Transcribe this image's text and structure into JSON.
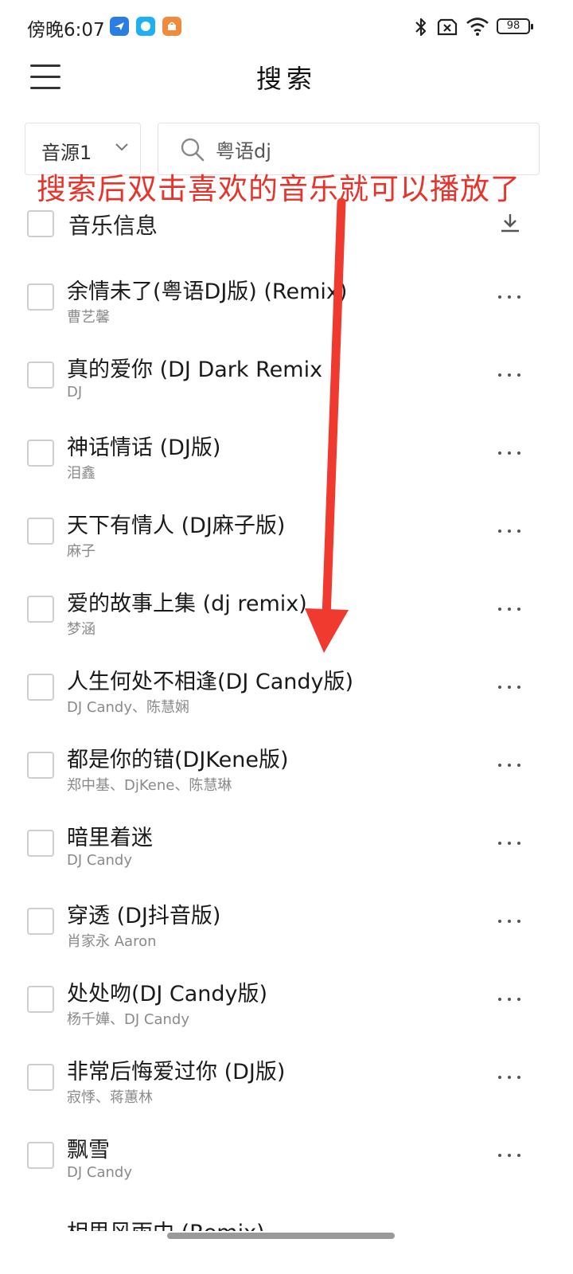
{
  "status_bar": {
    "time": "傍晚6:07",
    "battery": "98",
    "app_icons": [
      "bird-app-icon",
      "chat-app-icon",
      "shop-app-icon"
    ],
    "system_icons": [
      "bluetooth-icon",
      "sim-off-icon",
      "wifi-icon",
      "battery-icon"
    ]
  },
  "header": {
    "title": "搜索",
    "menu_icon": "hamburger-menu-icon"
  },
  "search": {
    "source_label": "音源1",
    "query": "粤语dj"
  },
  "list": {
    "header_label": "音乐信息",
    "songs": [
      {
        "title": "余情未了(粤语DJ版) (Remix)",
        "artist": "曹艺馨"
      },
      {
        "title": "真的爱你 (DJ Dark Remix",
        "artist": "DJ"
      },
      {
        "title": "神话情话 (DJ版)",
        "artist": "泪鑫"
      },
      {
        "title": "天下有情人 (DJ麻子版)",
        "artist": "麻子"
      },
      {
        "title": "爱的故事上集 (dj remix)",
        "artist": "梦涵"
      },
      {
        "title": "人生何处不相逢(DJ Candy版)",
        "artist": "DJ Candy、陈慧娴"
      },
      {
        "title": "都是你的错(DJKene版)",
        "artist": "郑中基、DjKene、陈慧琳"
      },
      {
        "title": "暗里着迷",
        "artist": "DJ Candy"
      },
      {
        "title": "穿透 (DJ抖音版)",
        "artist": "肖家永 Aaron"
      },
      {
        "title": "处处吻(DJ Candy版)",
        "artist": "杨千嬅、DJ Candy"
      },
      {
        "title": "非常后悔爱过你 (DJ版)",
        "artist": "寂悸、蒋蕙林"
      },
      {
        "title": "飘雪",
        "artist": "DJ Candy"
      }
    ],
    "partial_row_title": "相思风雨中 (Remix)"
  },
  "annotation": {
    "text": "搜索后双击喜欢的音乐就可以播放了",
    "color": "#e8332b"
  },
  "colors": {
    "accent": "#e8332b",
    "text_primary": "#1a1a1a",
    "text_secondary": "#8a8a8a",
    "border": "#e3e3e3"
  }
}
